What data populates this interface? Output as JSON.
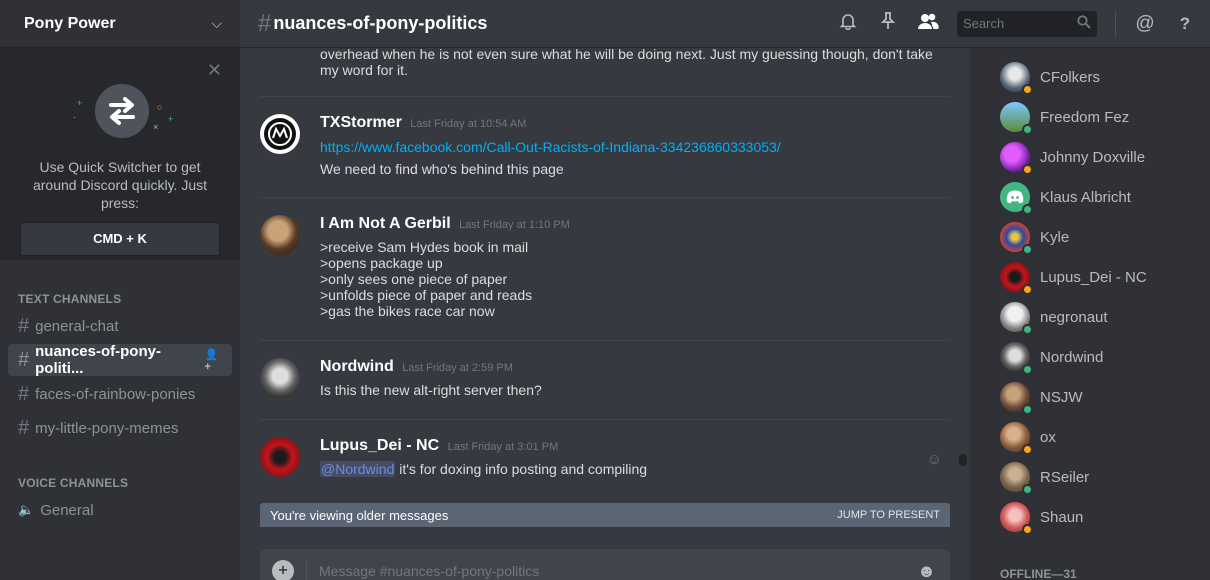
{
  "server": {
    "name": "Pony Power"
  },
  "quick_switcher": {
    "text": "Use Quick Switcher to get around Discord quickly. Just press:",
    "shortcut": "CMD + K"
  },
  "categories": {
    "text": "TEXT CHANNELS",
    "voice": "VOICE CHANNELS"
  },
  "channels": [
    {
      "name": "general-chat",
      "active": false
    },
    {
      "name": "nuances-of-pony-politi...",
      "active": true
    },
    {
      "name": "faces-of-rainbow-ponies",
      "active": false
    },
    {
      "name": "my-little-pony-memes",
      "active": false
    }
  ],
  "voice_channels": [
    {
      "name": "General"
    }
  ],
  "header": {
    "channel": "nuances-of-pony-politics",
    "search_placeholder": "Search"
  },
  "messages": {
    "continued_text": "overhead when he is not even sure what he will be doing next. Just my guessing though, don't take my word for it.",
    "list": [
      {
        "author": "TXStormer",
        "time": "Last Friday at 10:54 AM",
        "link": "https://www.facebook.com/Call-Out-Racists-of-Indiana-334236860333053/",
        "lines": [
          "We need to find who's behind this page"
        ]
      },
      {
        "author": "I Am Not A Gerbil",
        "time": "Last Friday at 1:10 PM",
        "lines": [
          ">receive Sam Hydes book in mail",
          ">opens package up",
          ">only sees one piece of paper",
          ">unfolds piece of paper and reads",
          ">gas the bikes race car now"
        ]
      },
      {
        "author": "Nordwind",
        "time": "Last Friday at 2:59 PM",
        "lines": [
          "Is this the new alt-right server then?"
        ]
      },
      {
        "author": "Lupus_Dei - NC",
        "time": "Last Friday at 3:01 PM",
        "mention": "@Nordwind",
        "rest": " it's for doxing info posting and compiling"
      }
    ]
  },
  "older_banner": {
    "text": "You're viewing older messages",
    "jump": "JUMP TO PRESENT"
  },
  "composer": {
    "placeholder": "Message #nuances-of-pony-politics"
  },
  "members": [
    {
      "name": "CFolkers",
      "status": "#faa61a"
    },
    {
      "name": "Freedom Fez",
      "status": "#43b581"
    },
    {
      "name": "Johnny Doxville",
      "status": "#faa61a"
    },
    {
      "name": "Klaus Albricht",
      "status": "#43b581"
    },
    {
      "name": "Kyle",
      "status": "#43b581"
    },
    {
      "name": "Lupus_Dei - NC",
      "status": "#faa61a"
    },
    {
      "name": "negronaut",
      "status": "#43b581"
    },
    {
      "name": "Nordwind",
      "status": "#43b581"
    },
    {
      "name": "NSJW",
      "status": "#43b581"
    },
    {
      "name": "ox",
      "status": "#faa61a"
    },
    {
      "name": "RSeiler",
      "status": "#43b581"
    },
    {
      "name": "Shaun",
      "status": "#faa61a"
    }
  ],
  "members_offline": {
    "label": "OFFLINE—31"
  },
  "colors": {
    "link": "#00b0f4",
    "mention": "#7289da",
    "online": "#43b581",
    "idle": "#faa61a"
  }
}
